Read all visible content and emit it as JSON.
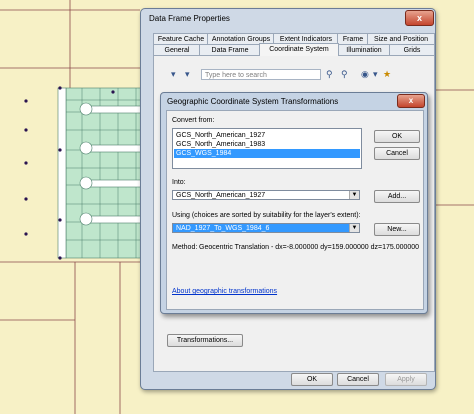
{
  "dfp": {
    "title": "Data Frame Properties",
    "close_label": "x",
    "tabs_row1": [
      "Feature Cache",
      "Annotation Groups",
      "Extent Indicators",
      "Frame",
      "Size and Position"
    ],
    "tabs_row2": [
      "General",
      "Data Frame",
      "Coordinate System",
      "Illumination",
      "Grids"
    ],
    "search_placeholder": "Type here to search",
    "transformations_label": "Transformations...",
    "ok_label": "OK",
    "cancel_label": "Cancel",
    "apply_label": "Apply"
  },
  "gcst": {
    "title": "Geographic Coordinate System Transformations",
    "close_label": "x",
    "convert_from_label": "Convert from:",
    "convert_from_items": [
      "GCS_North_American_1927",
      "GCS_North_American_1983",
      "GCS_WGS_1984"
    ],
    "selected_index": 2,
    "into_label": "Into:",
    "into_value": "GCS_North_American_1927",
    "using_label": "Using (choices are sorted by suitability for the layer's extent):",
    "using_value": "NAD_1927_To_WGS_1984_6",
    "method_label": "Method:",
    "method_value": "Geocentric Translation - dx=-8.000000 dy=159.000000 dz=175.000000",
    "about_link": "About geographic transformations",
    "ok_label": "OK",
    "cancel_label": "Cancel",
    "add_label": "Add...",
    "new_label": "New..."
  },
  "colors": {
    "map_background": "#f7f1c6",
    "parcel_fill": "#bfe6cc",
    "selection": "#3399ff"
  }
}
